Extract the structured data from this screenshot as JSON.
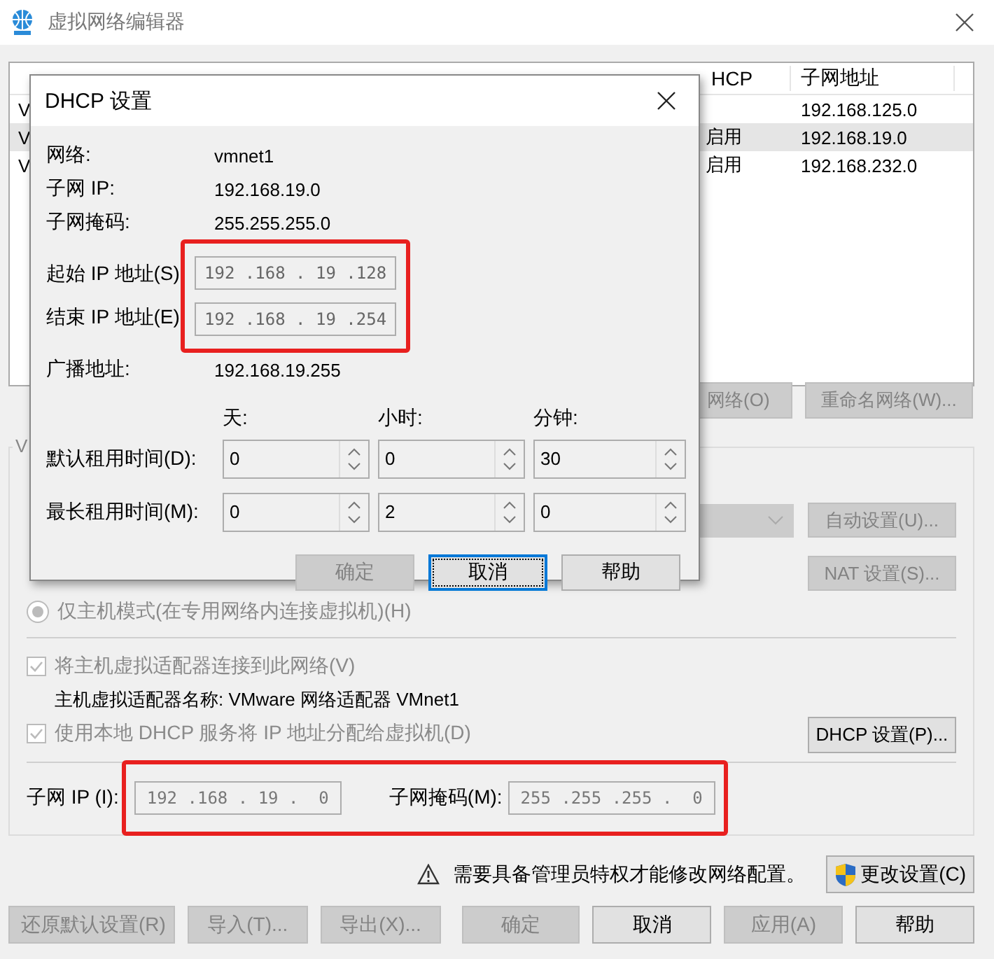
{
  "window": {
    "title": "虚拟网络编辑器"
  },
  "network_list": {
    "columns": [
      "HCP",
      "子网地址"
    ],
    "rows": [
      {
        "name": "V",
        "subnet": "192.168.125.0",
        "selected": false
      },
      {
        "name": "V",
        "dhcp": "启用",
        "subnet": "192.168.19.0",
        "selected": true
      },
      {
        "name": "V",
        "dhcp": "启用",
        "subnet": "192.168.232.0",
        "selected": false
      }
    ]
  },
  "list_buttons": [
    {
      "label": "网络(O)",
      "disabled": true
    },
    {
      "label": "重命名网络(W)...",
      "disabled": true
    }
  ],
  "settings_group": {
    "label": "V",
    "side_buttons": [
      {
        "label": "自动设置(U)...",
        "disabled": true
      },
      {
        "label": "NAT 设置(S)...",
        "disabled": true
      }
    ],
    "host_only_radio": {
      "label": "仅主机模式(在专用网络内连接虚拟机)(H)",
      "selected": true,
      "disabled": true
    },
    "checkboxes": [
      {
        "label": "将主机虚拟适配器连接到此网络(V)",
        "checked": true,
        "disabled": true
      },
      {
        "label": "使用本地 DHCP 服务将 IP 地址分配给虚拟机(D)",
        "checked": true,
        "disabled": true
      }
    ],
    "adapter_name": "主机虚拟适配器名称: VMware 网络适配器 VMnet1",
    "dhcp_button": "DHCP 设置(P)...",
    "subnet": {
      "highlight": true,
      "ip_label": "子网 IP (I):",
      "ip": "192 .168 . 19 .  0",
      "mask_label": "子网掩码(M):",
      "mask": "255 .255 .255 .  0"
    }
  },
  "warning": "需要具备管理员特权才能修改网络配置。",
  "change_settings_button": "更改设置(C)",
  "footer_buttons": [
    {
      "label": "还原默认设置(R)",
      "disabled": true
    },
    {
      "label": "导入(T)...",
      "disabled": true
    },
    {
      "label": "导出(X)...",
      "disabled": true
    },
    {
      "label": "确定",
      "disabled": true
    },
    {
      "label": "取消",
      "disabled": false
    },
    {
      "label": "应用(A)",
      "disabled": true
    },
    {
      "label": "帮助",
      "disabled": false
    }
  ],
  "dialog": {
    "title": "DHCP 设置",
    "info": [
      {
        "label": "网络:",
        "value": "vmnet1"
      },
      {
        "label": "子网 IP:",
        "value": "192.168.19.0"
      },
      {
        "label": "子网掩码:",
        "value": "255.255.255.0"
      }
    ],
    "ip_range": {
      "highlight": true,
      "fields": [
        {
          "label": "起始 IP 地址(S)",
          "value": "192 .168 . 19 .128"
        },
        {
          "label": "结束 IP 地址(E)",
          "value": "192 .168 . 19 .254"
        }
      ]
    },
    "broadcast": {
      "label": "广播地址:",
      "value": "192.168.19.255"
    },
    "lease_columns": [
      "天:",
      "小时:",
      "分钟:"
    ],
    "leases": [
      {
        "label": "默认租用时间(D):",
        "values": [
          "0",
          "0",
          "30"
        ]
      },
      {
        "label": "最长租用时间(M):",
        "values": [
          "0",
          "2",
          "0"
        ]
      }
    ],
    "buttons": [
      {
        "label": "确定",
        "disabled": true,
        "focused": false
      },
      {
        "label": "取消",
        "disabled": false,
        "focused": true
      },
      {
        "label": "帮助",
        "disabled": false,
        "focused": false
      }
    ]
  }
}
